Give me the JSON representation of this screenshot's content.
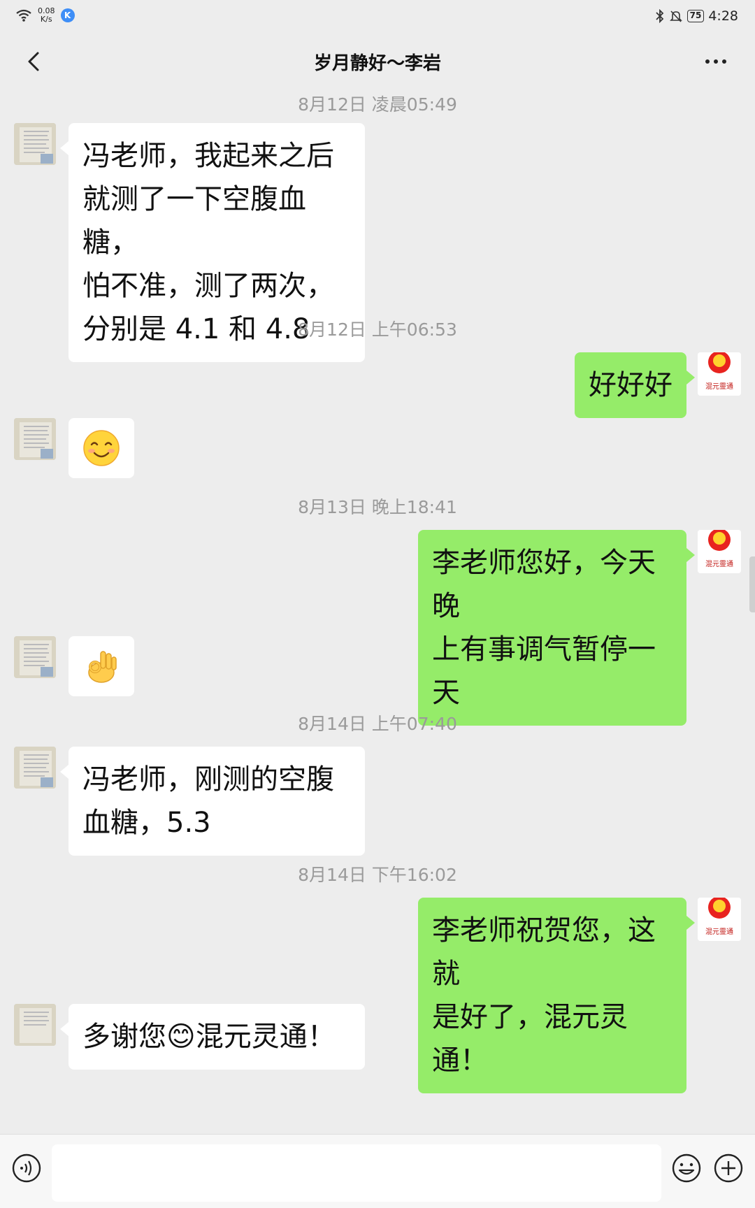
{
  "status_bar": {
    "net_speed_value": "0.08",
    "net_speed_unit": "K/s",
    "app_badge": "K",
    "battery": "75",
    "time": "4:28"
  },
  "header": {
    "title": "岁月静好～李岩"
  },
  "messages": [
    {
      "timestamp": "8月12日 凌晨05:49"
    },
    {
      "text": "冯老师，我起来之后\n就测了一下空腹血糖，\n怕不准，测了两次，\n分别是 4.1 和 4.8"
    },
    {
      "timestamp": "8月12日 上午06:53"
    },
    {
      "text": "好好好"
    },
    {
      "emoji": "smiling-face"
    },
    {
      "timestamp": "8月13日 晚上18:41"
    },
    {
      "text": "李老师您好，今天晚\n上有事调气暂停一天"
    },
    {
      "emoji": "ok-hand"
    },
    {
      "timestamp": "8月14日 上午07:40"
    },
    {
      "text": "冯老师，刚测的空腹\n血糖，5.3"
    },
    {
      "timestamp": "8月14日 下午16:02"
    },
    {
      "text": "李老师祝贺您，这就\n是好了，混元灵通！"
    },
    {
      "text": "多谢您😊混元灵通！"
    }
  ],
  "avatar_right_text": "混元靈通",
  "colors": {
    "background": "#ededed",
    "sent_bubble": "#95ec69",
    "received_bubble": "#ffffff",
    "timestamp_text": "#9a9a9a"
  }
}
